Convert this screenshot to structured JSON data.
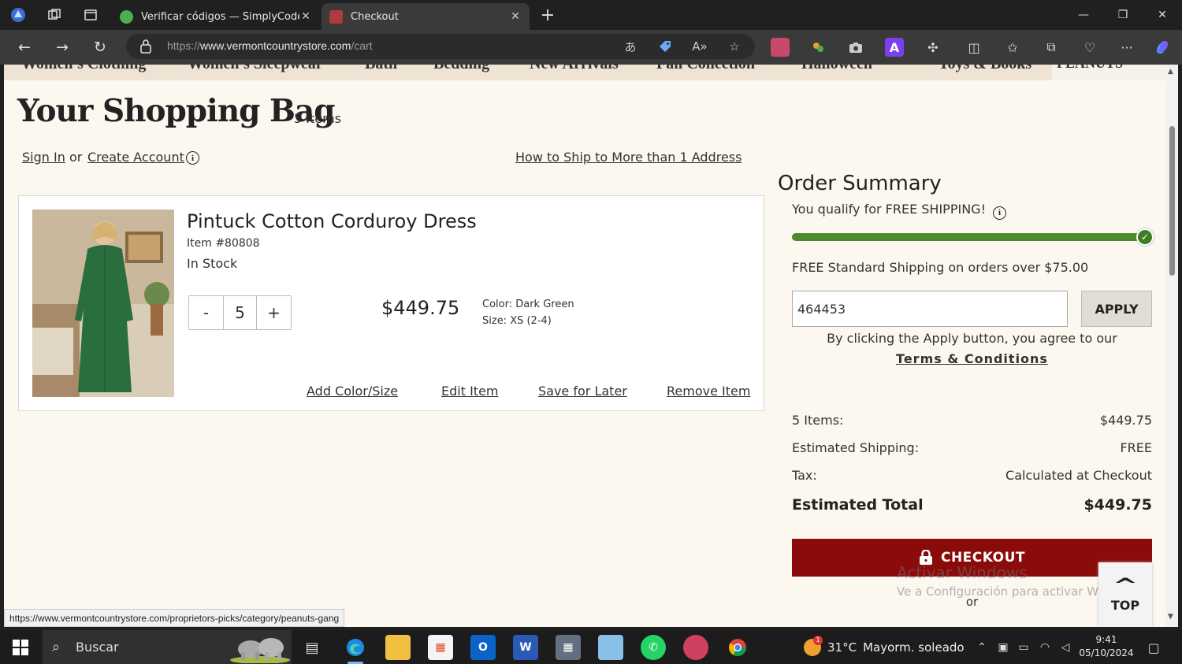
{
  "browser": {
    "tabs": [
      {
        "title": "Verificar códigos — SimplyCodes",
        "active": false
      },
      {
        "title": "Checkout",
        "active": true
      }
    ],
    "url_prefix": "https://",
    "url_domain": "www.vermontcountrystore.com",
    "url_path": "/cart",
    "status_url": "https://www.vermontcountrystore.com/proprietors-picks/category/peanuts-gang"
  },
  "nav": {
    "categories": [
      "Women's Clothing",
      "Women's Sleepwear",
      "Bath",
      "Bedding",
      "New Arrivals",
      "Fall Collection",
      "Halloween",
      "Toys & Books"
    ],
    "right": "PEANUTS"
  },
  "cart": {
    "title": "Your Shopping Bag",
    "count_label": "5 Items",
    "sign_in": "Sign In",
    "or": "or",
    "create_account": "Create Account",
    "multi_ship": "How to Ship to More than 1 Address"
  },
  "item": {
    "name": "Pintuck Cotton Corduroy Dress",
    "sku": "Item #80808",
    "stock": "In Stock",
    "qty_minus": "-",
    "qty": "5",
    "qty_plus": "+",
    "price": "$449.75",
    "color": "Color: Dark Green",
    "size": "Size: XS (2-4)",
    "add_color_size": "Add Color/Size",
    "edit": "Edit Item",
    "save_later": "Save for Later",
    "remove": "Remove Item"
  },
  "summary": {
    "title": "Order Summary",
    "free_shipping_msg": "You qualify for FREE SHIPPING!",
    "progress_percent": 100,
    "threshold_msg": "FREE Standard Shipping on orders over $75.00",
    "promo_value": "464453",
    "apply": "APPLY",
    "apply_note": "By clicking the Apply button, you agree to our",
    "terms": "Terms & Conditions",
    "rows": [
      {
        "label": "5 Items:",
        "value": "$449.75"
      },
      {
        "label": "Estimated Shipping:",
        "value": "FREE"
      },
      {
        "label": "Tax:",
        "value": "Calculated at Checkout"
      }
    ],
    "total_label": "Estimated Total",
    "total_value": "$449.75",
    "checkout": "CHECKOUT",
    "or": "or"
  },
  "overlay": {
    "top": "TOP",
    "activate_title": "Activar Windows",
    "activate_sub": "Ve a Configuración para activar Windows."
  },
  "taskbar": {
    "search_placeholder": "Buscar",
    "weather_temp": "31°C",
    "weather_desc": "Mayorm. soleado",
    "time": "9:41",
    "date": "05/10/2024",
    "weather_badge": "1"
  },
  "colors": {
    "checkout_bg": "#8b0b0b",
    "progress_fill": "#4b8b2a",
    "page_bg": "#fcf7ef"
  }
}
